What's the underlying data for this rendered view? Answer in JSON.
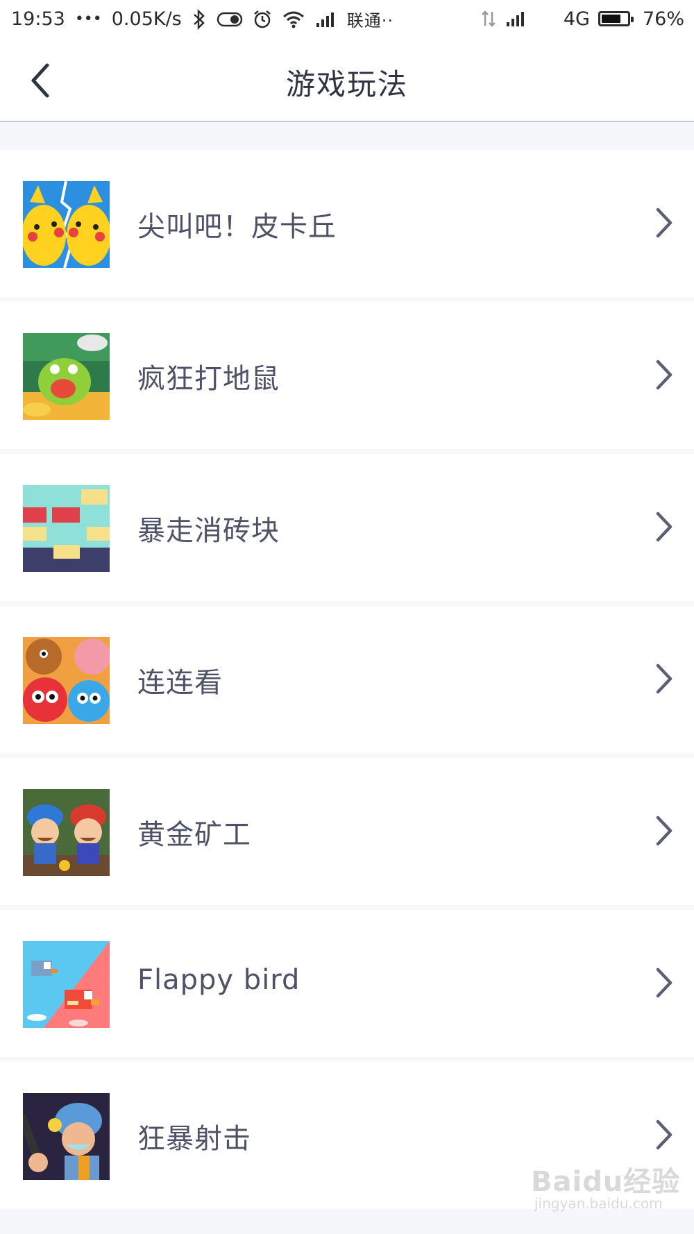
{
  "status_bar": {
    "time": "19:53",
    "dots": "•••",
    "net_speed": "0.05K/s",
    "carrier": "联通··",
    "network_type": "4G",
    "battery_percent_label": "76%",
    "battery_level": 0.76,
    "icons": [
      "bluetooth-icon",
      "toggle-icon",
      "alarm-icon",
      "wifi-icon",
      "signal-icon",
      "data-transfer-icon",
      "signal-icon-2",
      "battery-icon"
    ]
  },
  "header": {
    "title": "游戏玩法",
    "back_icon": "chevron-left-icon"
  },
  "games": [
    {
      "name": "尖叫吧！皮卡丘",
      "thumb": "pikachu-thumbnail"
    },
    {
      "name": "疯狂打地鼠",
      "thumb": "whack-a-mole-thumbnail"
    },
    {
      "name": "暴走消砖块",
      "thumb": "brick-breaker-thumbnail"
    },
    {
      "name": "连连看",
      "thumb": "link-match-thumbnail"
    },
    {
      "name": "黄金矿工",
      "thumb": "gold-miner-thumbnail"
    },
    {
      "name": "Flappy bird",
      "thumb": "flappy-bird-thumbnail"
    },
    {
      "name": "狂暴射击",
      "thumb": "rampage-shooter-thumbnail"
    }
  ],
  "watermark": {
    "text": "Baidu经验",
    "sub": "jingyan.baidu.com"
  },
  "colors": {
    "background": "#f6f7fb",
    "title": "#2f3442",
    "item_text": "#4e5266",
    "chevron": "#5a5f73"
  }
}
